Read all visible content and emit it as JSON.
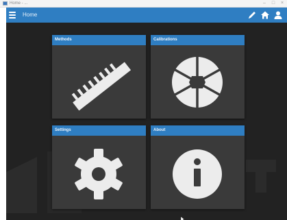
{
  "window": {
    "title": "Home - ..."
  },
  "toolbar": {
    "title": "Home",
    "icons": [
      "edit-icon",
      "home-icon",
      "user-icon"
    ]
  },
  "tiles": [
    {
      "label": "Methods",
      "icon": "ruler-icon"
    },
    {
      "label": "Calibrations",
      "icon": "aperture-icon"
    },
    {
      "label": "Settings",
      "icon": "gear-icon"
    },
    {
      "label": "About",
      "icon": "info-icon"
    }
  ],
  "colors": {
    "accent": "#2f7ec2",
    "background": "#222222",
    "tile": "#3a3a3a",
    "icon": "#ececec"
  }
}
